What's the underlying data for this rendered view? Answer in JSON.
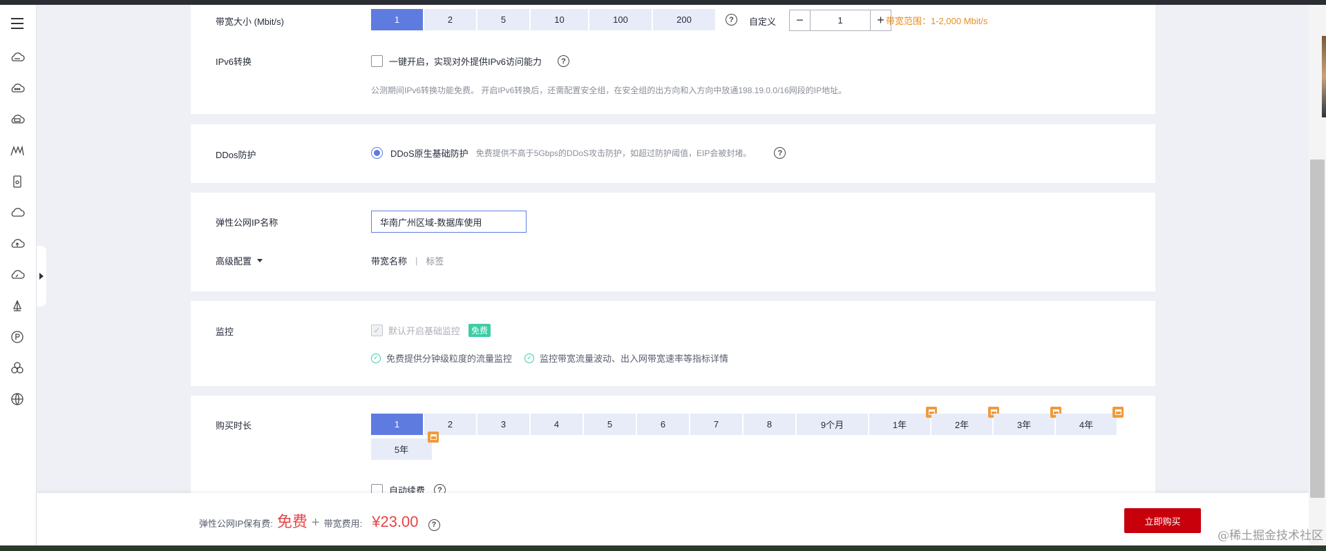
{
  "sidebar": {
    "icons": [
      "menu-icon",
      "cloud-server-icon",
      "cloud-dots-icon",
      "cloud-hdd-icon",
      "mountain-icon",
      "mobile-icon",
      "cloud-icon",
      "cloud-upload-icon",
      "cloud-speed-icon",
      "sail-icon",
      "parking-icon",
      "cluster-icon",
      "globe-icon"
    ]
  },
  "bandwidth": {
    "label": "带宽大小 (Mbit/s)",
    "options": [
      "1",
      "2",
      "5",
      "10",
      "100",
      "200"
    ],
    "selected": "1",
    "custom_label": "自定义",
    "stepper_minus": "−",
    "stepper_value": "1",
    "stepper_plus": "+",
    "range_hint": "带宽范围：1-2,000 Mbit/s"
  },
  "ipv6": {
    "label": "IPv6转换",
    "checkbox_label": "一键开启，实现对外提供IPv6访问能力",
    "note": "公测期间IPv6转换功能免费。 开启IPv6转换后，还需配置安全组，在安全组的出方向和入方向中放通198.19.0.0/16网段的IP地址。"
  },
  "ddos": {
    "label": "DDos防护",
    "option_label": "DDoS原生基础防护",
    "option_desc": "免费提供不高于5Gbps的DDoS攻击防护，如超过防护阈值，EIP会被封堵。"
  },
  "eip_name": {
    "label": "弹性公网IP名称",
    "value": "华南广州区域-数据库使用"
  },
  "advanced": {
    "label": "高级配置",
    "tab_bandwidth_name": "带宽名称",
    "separator": "|",
    "tab_tags": "标签"
  },
  "monitor": {
    "label": "监控",
    "checkbox_label": "默认开启基础监控",
    "free_badge": "免费",
    "feature1": "免费提供分钟级粒度的流量监控",
    "feature2": "监控带宽流量波动、出入网带宽速率等指标详情"
  },
  "duration": {
    "label": "购买时长",
    "options": [
      "1",
      "2",
      "3",
      "4",
      "5",
      "6",
      "7",
      "8",
      "9个月",
      "1年",
      "2年",
      "3年",
      "4年",
      "5年"
    ],
    "selected": "1",
    "auto_renew_label": "自动续费"
  },
  "footer": {
    "retain_label": "弹性公网IP保有费:",
    "retain_value": "免费",
    "plus": "+",
    "bandwidth_fee_label": "带宽费用:",
    "bandwidth_fee_value": "¥23.00",
    "buy_button": "立即购买"
  },
  "watermark": "@稀土掘金技术社区"
}
